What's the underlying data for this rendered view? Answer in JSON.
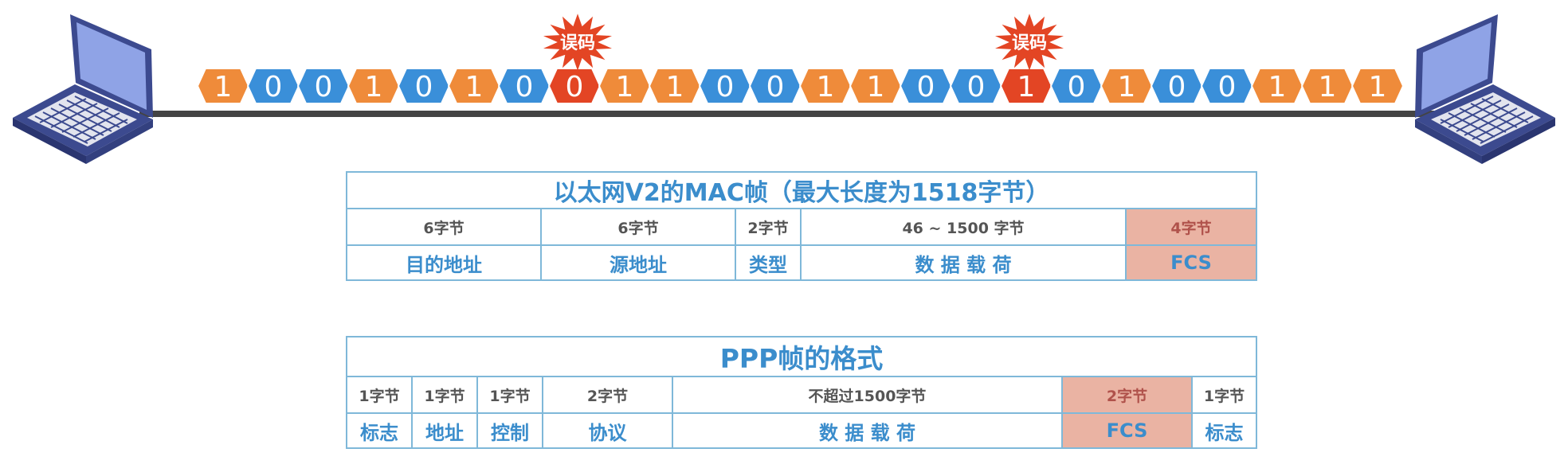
{
  "bit_stream": {
    "bits": [
      1,
      0,
      0,
      1,
      0,
      1,
      0,
      0,
      1,
      1,
      0,
      0,
      1,
      1,
      0,
      0,
      1,
      0,
      1,
      0,
      0,
      1,
      1,
      1
    ],
    "error_bits": [
      7,
      16
    ],
    "error_label": "误码",
    "colors": {
      "one": "#ef8b3a",
      "zero": "#3a8fd9",
      "error": "#e34524",
      "line": "#444444"
    }
  },
  "mac_frame": {
    "title": "以太网V2的MAC帧（最大长度为1518字节）",
    "fields": [
      {
        "size": "6字节",
        "name": "目的地址"
      },
      {
        "size": "6字节",
        "name": "源地址"
      },
      {
        "size": "2字节",
        "name": "类型"
      },
      {
        "size": "46 ~ 1500 字节",
        "name": "数 据 载 荷"
      },
      {
        "size": "4字节",
        "name": "FCS"
      }
    ]
  },
  "ppp_frame": {
    "title": "PPP帧的格式",
    "fields": [
      {
        "size": "1字节",
        "name": "标志"
      },
      {
        "size": "1字节",
        "name": "地址"
      },
      {
        "size": "1字节",
        "name": "控制"
      },
      {
        "size": "2字节",
        "name": "协议"
      },
      {
        "size": "不超过1500字节",
        "name": "数 据 载 荷"
      },
      {
        "size": "2字节",
        "name": "FCS"
      },
      {
        "size": "1字节",
        "name": "标志"
      }
    ]
  }
}
